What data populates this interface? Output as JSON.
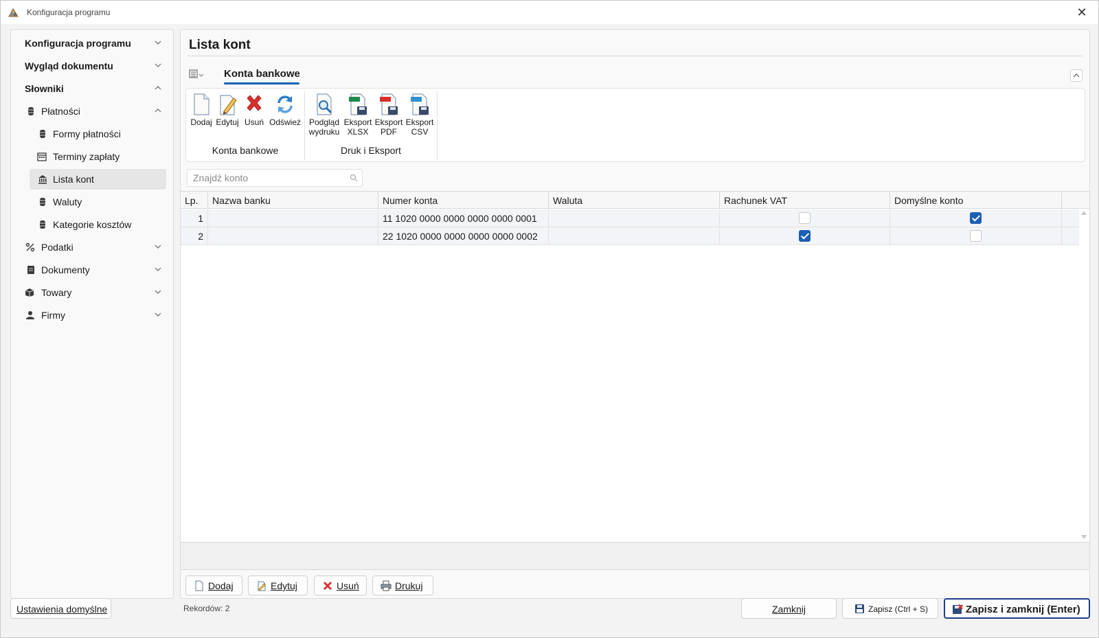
{
  "window": {
    "title": "Konfiguracja programu",
    "close_glyph": "✕"
  },
  "sidebar": {
    "items": [
      {
        "label": "Konfiguracja programu",
        "icon": "",
        "chevron": "down"
      },
      {
        "label": "Wygląd dokumentu",
        "icon": "",
        "chevron": "down"
      },
      {
        "label": "Słowniki",
        "icon": "",
        "chevron": "up"
      },
      {
        "label": "Płatności",
        "icon": "cylinder-icon",
        "chevron": "up"
      },
      {
        "label": "Formy płatności",
        "icon": "cylinder-icon"
      },
      {
        "label": "Terminy zapłaty",
        "icon": "calendar-icon"
      },
      {
        "label": "Lista kont",
        "icon": "bank-icon",
        "selected": true
      },
      {
        "label": "Waluty",
        "icon": "cylinder-icon"
      },
      {
        "label": "Kategorie kosztów",
        "icon": "cylinder-icon"
      },
      {
        "label": "Podatki",
        "icon": "percent-icon",
        "chevron": "down"
      },
      {
        "label": "Dokumenty",
        "icon": "document-icon",
        "chevron": "down"
      },
      {
        "label": "Towary",
        "icon": "box-icon",
        "chevron": "down"
      },
      {
        "label": "Firmy",
        "icon": "person-icon",
        "chevron": "down"
      }
    ]
  },
  "main": {
    "title": "Lista kont",
    "ribbon": {
      "tab": "Konta bankowe",
      "groups": [
        {
          "label": "Konta bankowe",
          "buttons": [
            {
              "label": "Dodaj",
              "icon": "new-document-icon"
            },
            {
              "label": "Edytuj",
              "icon": "edit-pencil-icon"
            },
            {
              "label": "Usuń",
              "icon": "delete-x-icon"
            },
            {
              "label": "Odśwież",
              "icon": "refresh-icon"
            }
          ]
        },
        {
          "label": "Druk i Eksport",
          "buttons": [
            {
              "label_line1": "Podgląd",
              "label_line2": "wydruku",
              "icon": "print-preview-icon"
            },
            {
              "label_line1": "Eksport",
              "label_line2": "XLSX",
              "icon": "export-xlsx-icon"
            },
            {
              "label_line1": "Eksport",
              "label_line2": "PDF",
              "icon": "export-pdf-icon"
            },
            {
              "label_line1": "Eksport",
              "label_line2": "CSV",
              "icon": "export-csv-icon"
            }
          ]
        }
      ]
    },
    "search": {
      "placeholder": "Znajdź konto",
      "value": ""
    },
    "table": {
      "columns": [
        "Lp.",
        "Nazwa banku",
        "Numer konta",
        "Waluta",
        "Rachunek VAT",
        "Domyślne konto"
      ],
      "rows": [
        {
          "lp": "1",
          "bank": "",
          "number": "11 1020 0000 0000 0000 0000 0001",
          "currency": "",
          "vat": false,
          "default": true
        },
        {
          "lp": "2",
          "bank": "",
          "number": "22 1020 0000 0000 0000 0000 0002",
          "currency": "",
          "vat": true,
          "default": false
        }
      ]
    },
    "actions": {
      "add": "Dodaj",
      "edit": "Edytuj",
      "delete": "Usuń",
      "print": "Drukuj"
    },
    "records": "Rekordów: 2"
  },
  "bottom": {
    "defaults": "Ustawienia domyślne",
    "close": "Zamknij",
    "save": "Zapisz (Ctrl + S)",
    "save_close": "Zapisz i zamknij (Enter)"
  },
  "colors": {
    "accent": "#1d5fb3",
    "selected_row": "#e6e6e6",
    "delete_red": "#d9302c"
  }
}
